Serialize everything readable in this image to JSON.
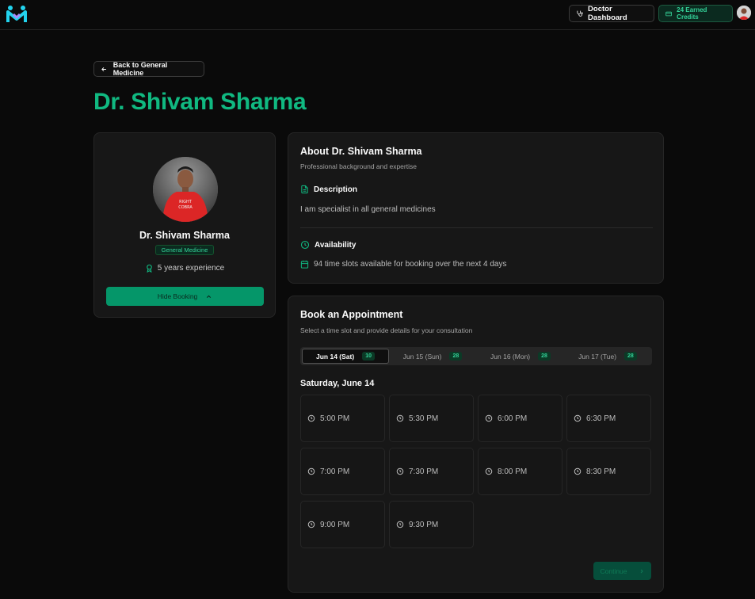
{
  "nav": {
    "doctor_dashboard": "Doctor Dashboard",
    "credits": "24 Earned Credits"
  },
  "back_label": "Back to General Medicine",
  "page_title": "Dr. Shivam Sharma",
  "profile": {
    "name": "Dr. Shivam Sharma",
    "specialty": "General Medicine",
    "experience": "5 years experience",
    "hide_booking": "Hide Booking"
  },
  "about": {
    "title": "About Dr. Shivam Sharma",
    "subtitle": "Professional background and expertise",
    "description_heading": "Description",
    "description": "I am specialist in all general medicines",
    "availability_heading": "Availability",
    "availability": "94 time slots available for booking over the next 4 days"
  },
  "booking": {
    "title": "Book an Appointment",
    "subtitle": "Select a time slot and provide details for your consultation",
    "tabs": [
      {
        "label": "Jun 14  (Sat)",
        "count": "10"
      },
      {
        "label": "Jun 15  (Sun)",
        "count": "28"
      },
      {
        "label": "Jun 16  (Mon)",
        "count": "28"
      },
      {
        "label": "Jun 17  (Tue)",
        "count": "28"
      }
    ],
    "day_heading": "Saturday, June 14",
    "slots": [
      "5:00 PM",
      "5:30 PM",
      "6:00 PM",
      "6:30 PM",
      "7:00 PM",
      "7:30 PM",
      "8:00 PM",
      "8:30 PM",
      "9:00 PM",
      "9:30 PM"
    ],
    "continue": "Continue"
  },
  "colors": {
    "accent": "#10b981",
    "background": "#0a0a0a",
    "card": "#171717"
  }
}
